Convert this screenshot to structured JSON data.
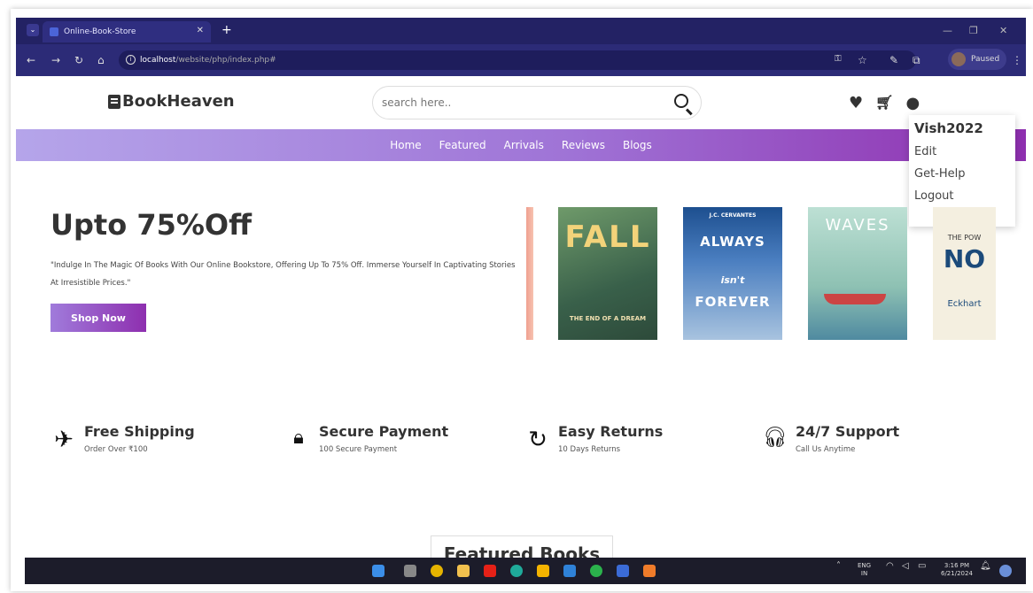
{
  "browser": {
    "tab_title": "Online-Book-Store",
    "tab_close": "✕",
    "new_tab": "+",
    "url_host": "localhost",
    "url_path": "/website/php/index.php#",
    "profile_status": "Paused"
  },
  "site": {
    "logo": "BookHeaven",
    "search_placeholder": "search here..",
    "nav": [
      "Home",
      "Featured",
      "Arrivals",
      "Reviews",
      "Blogs"
    ]
  },
  "user_menu": {
    "username": "Vish2022",
    "items": [
      "Edit",
      "Get-Help",
      "Logout"
    ]
  },
  "hero": {
    "title": "Upto 75%Off",
    "text": "\"Indulge In The Magic Of Books With Our Online Bookstore, Offering Up To 75% Off. Immerse Yourself In Captivating Stories At Irresistible Prices.\"",
    "button": "Shop Now"
  },
  "books": [
    {
      "title": "FALL",
      "subtitle": "THE END OF A DREAM"
    },
    {
      "author": "J.C. CERVANTES",
      "title": "ALWAYS",
      "mid": "isn't",
      "end": "FOREVER"
    },
    {
      "title": "WAVES"
    },
    {
      "top": "THE POW",
      "title": "NO",
      "author": "Eckhart"
    }
  ],
  "features": [
    {
      "icon": "plane-icon",
      "title": "Free Shipping",
      "sub": "Order Over ₹100"
    },
    {
      "icon": "lock-icon",
      "title": "Secure Payment",
      "sub": "100 Secure Payment"
    },
    {
      "icon": "refresh-icon",
      "title": "Easy Returns",
      "sub": "10 Days Returns"
    },
    {
      "icon": "headset-icon",
      "title": "24/7 Support",
      "sub": "Call Us Anytime"
    }
  ],
  "section_heading": "Featured Books",
  "taskbar": {
    "lang": "ENG",
    "region": "IN",
    "time": "3:16 PM",
    "date": "6/21/2024"
  }
}
